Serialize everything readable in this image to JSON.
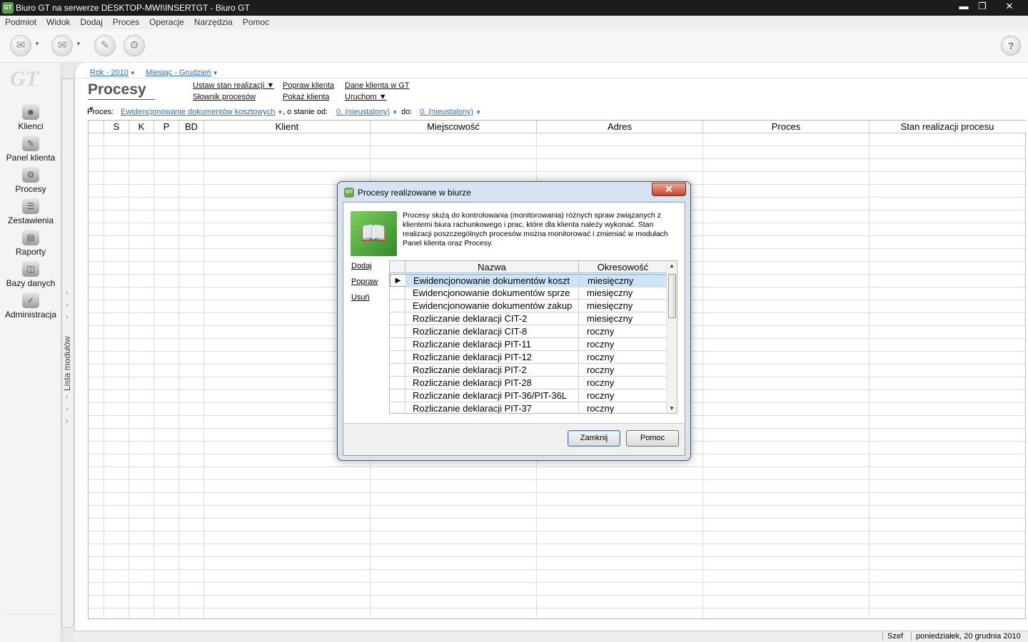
{
  "window": {
    "title": "Biuro GT na serwerze DESKTOP-MWI\\INSERTGT - Biuro GT",
    "icon_text": "GT",
    "controls": [
      "minimize-icon",
      "restore-icon",
      "close-icon"
    ]
  },
  "menu": [
    "Podmiot",
    "Widok",
    "Dodaj",
    "Proces",
    "Operacje",
    "Narzędzia",
    "Pomoc"
  ],
  "logo_text": "GT",
  "nav": [
    {
      "label": "Klienci",
      "icon": "person-icon"
    },
    {
      "label": "Panel klienta",
      "icon": "panel-icon"
    },
    {
      "label": "Procesy",
      "icon": "gears-icon"
    },
    {
      "label": "Zestawienia",
      "icon": "stack-icon"
    },
    {
      "label": "Raporty",
      "icon": "report-icon"
    },
    {
      "label": "Bazy danych",
      "icon": "database-icon"
    },
    {
      "label": "Administracja",
      "icon": "admin-icon"
    }
  ],
  "module_strip_label": "Lista modułów",
  "period": {
    "year": "Rok - 2010",
    "month": "Miesiąc - Grudzień"
  },
  "page": {
    "title": "Procesy",
    "links": {
      "set_status": "Ustaw stan realizacji",
      "process_dict": "Słownik procesów",
      "fix_client": "Popraw klienta",
      "show_client": "Pokaż klienta",
      "client_data": "Dane klienta w GT",
      "run": "Uruchom"
    },
    "filter": {
      "label": "Proces:",
      "value": "Ewidencjonowanie dokumentów kosztowych",
      "from_label": ", o stanie od:",
      "from_value": "0. (nieustalony)",
      "to_label": "do:",
      "to_value": "0. (nieustalony)"
    }
  },
  "grid": {
    "columns": [
      "S",
      "K",
      "P",
      "BD",
      "Klient",
      "Miejscowość",
      "Adres",
      "Proces",
      "Stan realizacji procesu"
    ]
  },
  "status": {
    "user": "Szef",
    "date": "poniedziałek, 20 grudnia 2010"
  },
  "dialog": {
    "title": "Procesy realizowane w biurze",
    "description": "Procesy służą do kontrolowania (monitorowania) różnych spraw związanych z klientemi biura rachunkowego i prac, które dla klienta należy wykonać. Stan realizacji poszczególnych procesów można monitorować i zmieniać w modułach Panel klienta oraz Procesy.",
    "actions": [
      "Dodaj",
      "Popraw",
      "Usuń"
    ],
    "columns": [
      "Nazwa",
      "Okresowość"
    ],
    "rows": [
      {
        "name": "Ewidencjonowanie dokumentów koszt",
        "period": "miesięczny"
      },
      {
        "name": "Ewidencjonowanie dokumentów sprze",
        "period": "miesięczny"
      },
      {
        "name": "Ewidencjonowanie dokumentów zakup",
        "period": "miesięczny"
      },
      {
        "name": "Rozliczanie deklaracji CIT-2",
        "period": "miesięczny"
      },
      {
        "name": "Rozliczanie deklaracji CIT-8",
        "period": "roczny"
      },
      {
        "name": "Rozliczanie deklaracji PIT-11",
        "period": "roczny"
      },
      {
        "name": "Rozliczanie deklaracji PIT-12",
        "period": "roczny"
      },
      {
        "name": "Rozliczanie deklaracji PIT-2",
        "period": "roczny"
      },
      {
        "name": "Rozliczanie deklaracji PIT-28",
        "period": "roczny"
      },
      {
        "name": "Rozliczanie deklaracji PIT-36/PIT-36L",
        "period": "roczny"
      },
      {
        "name": "Rozliczanie deklaracji PIT-37",
        "period": "roczny"
      }
    ],
    "selected_index": 0,
    "buttons": {
      "close": "Zamknij",
      "help": "Pomoc"
    }
  }
}
